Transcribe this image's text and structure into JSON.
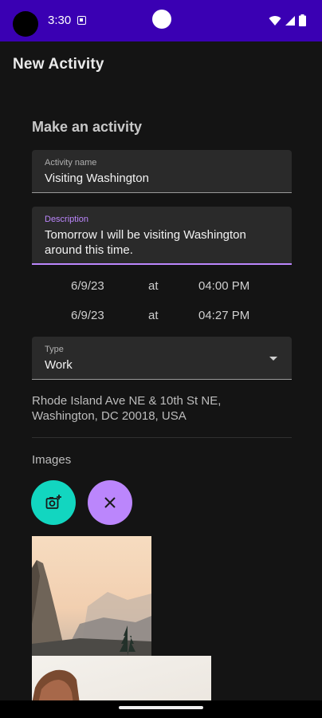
{
  "status_bar": {
    "time": "3:30"
  },
  "app_bar": {
    "title": "New Activity"
  },
  "form": {
    "section_title": "Make an activity",
    "activity_name": {
      "label": "Activity name",
      "value": "Visiting Washington"
    },
    "description": {
      "label": "Description",
      "value_line1": "Tomorrow I will be visiting Washington",
      "value_line2": "around this time."
    },
    "start": {
      "date": "6/9/23",
      "at": "at",
      "time": "04:00 PM"
    },
    "end": {
      "date": "6/9/23",
      "at": "at",
      "time": "04:27 PM"
    },
    "type": {
      "label": "Type",
      "value": "Work"
    },
    "address_line1": "Rhode Island Ave NE & 10th St NE,",
    "address_line2": "Washington, DC 20018, USA",
    "images_title": "Images"
  },
  "buttons": {
    "add_image_icon": "add-photo-icon",
    "clear_images_icon": "close-icon"
  },
  "colors": {
    "status_bar": "#3a00b3",
    "background": "#141414",
    "accent_purple": "#bb86fc",
    "accent_teal": "#12d6c0"
  }
}
